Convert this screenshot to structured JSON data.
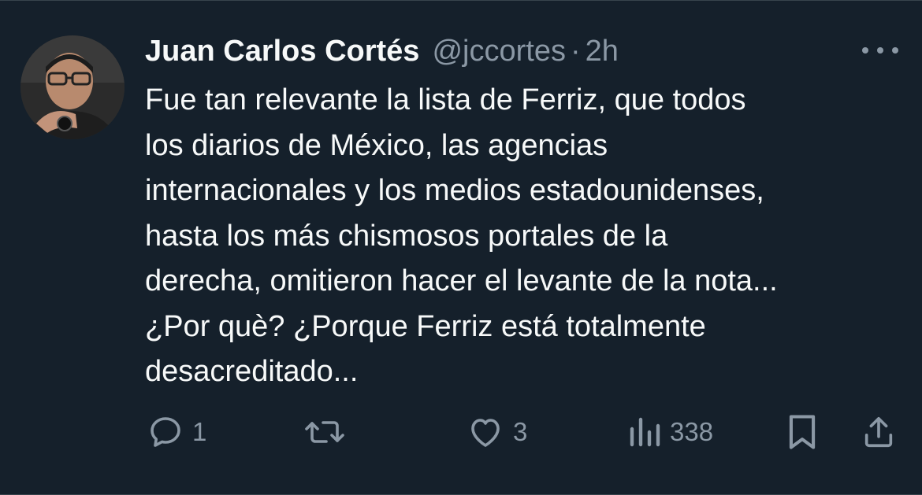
{
  "tweet": {
    "author_name": "Juan Carlos Cortés",
    "handle": "@jccortes",
    "separator": "·",
    "time": "2h",
    "text_lines": [
      "Fue tan relevante la lista de Ferriz, que todos",
      "los diarios de México, las agencias",
      "internacionales y los medios estadounidenses,",
      "hasta los más chismosos portales de la",
      "derecha, omitieron hacer el levante de la nota...",
      "¿Por què? ¿Porque Ferriz está totalmente",
      "desacreditado..."
    ]
  },
  "actions": {
    "reply": {
      "icon": "reply-icon",
      "count": "1"
    },
    "retweet": {
      "icon": "retweet-icon",
      "count": ""
    },
    "like": {
      "icon": "heart-icon",
      "count": "3"
    },
    "views": {
      "icon": "views-icon",
      "count": "338"
    },
    "bookmark": {
      "icon": "bookmark-icon"
    },
    "share": {
      "icon": "share-icon"
    }
  },
  "colors": {
    "background": "#15202b",
    "text": "#f7f9f9",
    "muted": "#8b98a5",
    "divider": "#38444d"
  }
}
